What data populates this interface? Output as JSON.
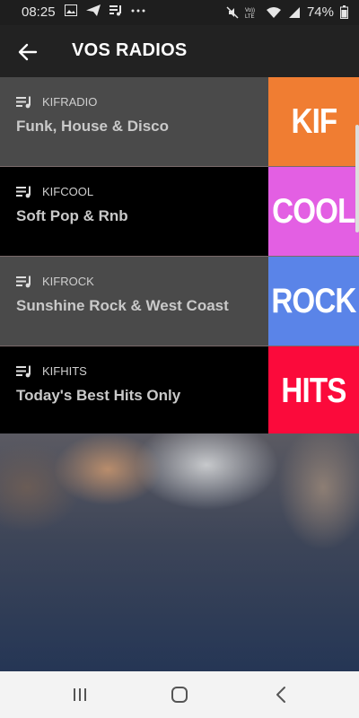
{
  "status_bar": {
    "time": "08:25",
    "battery": "74%",
    "left_icons": [
      "image-icon",
      "send-icon",
      "queue-music-icon",
      "more-icon"
    ],
    "right_icons": [
      "mute-icon",
      "volte-icon",
      "wifi-icon",
      "signal-icon",
      "battery-icon"
    ]
  },
  "app_bar": {
    "title": "VOS RADIOS",
    "back_icon": "arrow-back-icon"
  },
  "radios": [
    {
      "code": "KIFRADIO",
      "description": "Funk, House & Disco",
      "logo_text": "KIF",
      "logo_color": "#f07d32"
    },
    {
      "code": "KIFCOOL",
      "description": "Soft Pop & Rnb",
      "logo_text": "COOL",
      "logo_color": "#e35fe3"
    },
    {
      "code": "KIFROCK",
      "description": "Sunshine Rock & West Coast",
      "logo_text": "ROCK",
      "logo_color": "#5a84e8"
    },
    {
      "code": "KIFHITS",
      "description": "Today's Best Hits Only",
      "logo_text": "HITS",
      "logo_color": "#fb0a3b"
    }
  ],
  "nav_bar": {
    "buttons": [
      "recent-apps-icon",
      "home-icon",
      "back-icon"
    ]
  }
}
